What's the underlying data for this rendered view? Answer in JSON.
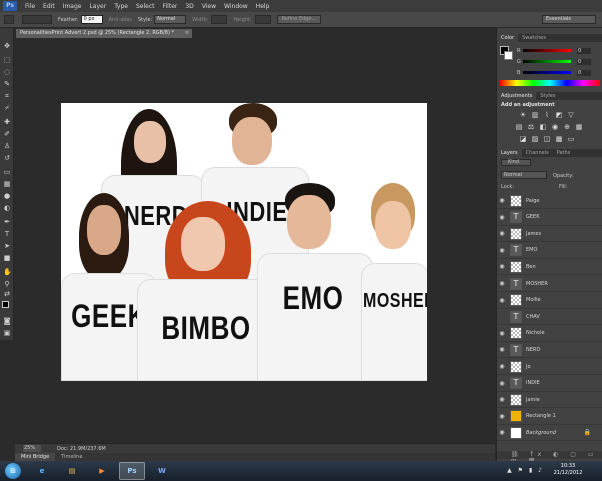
{
  "menubar": {
    "logo": "Ps",
    "items": [
      "File",
      "Edit",
      "Image",
      "Layer",
      "Type",
      "Select",
      "Filter",
      "3D",
      "View",
      "Window",
      "Help"
    ]
  },
  "options": {
    "feather_label": "Feather:",
    "feather_value": "0 px",
    "antialias_label": "Anti-alias",
    "style_label": "Style:",
    "style_value": "Normal",
    "width_label": "Width:",
    "height_label": "Height:",
    "refine_edge": "Refine Edge...",
    "workspace": "Essentials"
  },
  "document": {
    "tab_title": "PersonalitiesPrint Advert 2.psd @ 25% (Rectangle 2, RGB/8) *",
    "close_glyph": "×",
    "zoom": "25%",
    "doc_info": "Doc: 21.9M/237.6M"
  },
  "photo": {
    "people": [
      {
        "label": "NERD",
        "skin": "#e8c0a8",
        "hair": "#1e1410"
      },
      {
        "label": "INDIE",
        "skin": "#e2b496",
        "hair": "#3a2414"
      },
      {
        "label": "GEEK",
        "skin": "#d8a888",
        "hair": "#2a1a10"
      },
      {
        "label": "BIMBO",
        "skin": "#f0c8b0",
        "hair": "#c8461c"
      },
      {
        "label": "EMO",
        "skin": "#e4b898",
        "hair": "#1a1410"
      },
      {
        "label": "MOSHER",
        "skin": "#eec4a4",
        "hair": "#c89860"
      }
    ]
  },
  "bottom_tabs": [
    "Mini Bridge",
    "Timeline"
  ],
  "color_panel": {
    "tabs": [
      "Color",
      "Swatches"
    ],
    "r_label": "R",
    "g_label": "G",
    "b_label": "B",
    "r": "0",
    "g": "0",
    "b": "0"
  },
  "adjustments_panel": {
    "tabs": [
      "Adjustments",
      "Styles"
    ],
    "heading": "Add an adjustment"
  },
  "layers_panel": {
    "tabs": [
      "Layers",
      "Channels",
      "Paths"
    ],
    "filter": "Kind",
    "blend_mode": "Normal",
    "opacity_label": "Opacity:",
    "lock_label": "Lock:",
    "fill_label": "Fill:",
    "layers": [
      {
        "name": "Paige",
        "kind": "img",
        "visible": true
      },
      {
        "name": "GEEK",
        "kind": "text",
        "visible": true
      },
      {
        "name": "James",
        "kind": "img",
        "visible": true
      },
      {
        "name": "EMO",
        "kind": "text",
        "visible": true
      },
      {
        "name": "Ben",
        "kind": "img",
        "visible": true
      },
      {
        "name": "MOSHER",
        "kind": "text",
        "visible": true
      },
      {
        "name": "Mollie",
        "kind": "img",
        "visible": true
      },
      {
        "name": "CHAV",
        "kind": "text",
        "visible": false
      },
      {
        "name": "Nichole",
        "kind": "img",
        "visible": true
      },
      {
        "name": "NERD",
        "kind": "text",
        "visible": true
      },
      {
        "name": "Jo",
        "kind": "img",
        "visible": true
      },
      {
        "name": "INDIE",
        "kind": "text",
        "visible": true
      },
      {
        "name": "Jamie",
        "kind": "img",
        "visible": true
      },
      {
        "name": "Rectangle 1",
        "kind": "fill",
        "visible": true
      },
      {
        "name": "Background",
        "kind": "white",
        "visible": true
      }
    ]
  },
  "taskbar": {
    "start": "⊞",
    "apps": [
      "e",
      "▤",
      "▶",
      "Ps",
      "W"
    ],
    "tray": "▲ ⚑ ▮ ♪",
    "time": "10:33",
    "date": "21/12/2012"
  }
}
